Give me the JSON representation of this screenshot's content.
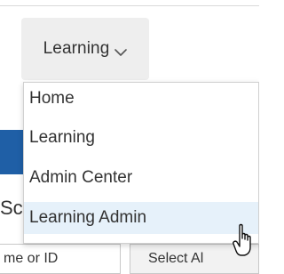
{
  "nav": {
    "dropdown_label": "Learning",
    "menu_items": [
      {
        "label": "Home"
      },
      {
        "label": "Learning"
      },
      {
        "label": "Admin Center"
      },
      {
        "label": "Learning Admin"
      }
    ],
    "hovered_item": "Learning Admin"
  },
  "background": {
    "partial_heading": "Sc",
    "name_id_field_text": "me or ID",
    "select_all_label": "Select Al"
  },
  "icons": {
    "dropdown_chevron": "chevron-down-icon",
    "cursor": "hand-pointer-icon"
  },
  "colors": {
    "button_bg": "#eeeeee",
    "menu_hover_bg": "#e6f1fa",
    "accent_blue": "#1f5fa6",
    "text": "#333333"
  }
}
